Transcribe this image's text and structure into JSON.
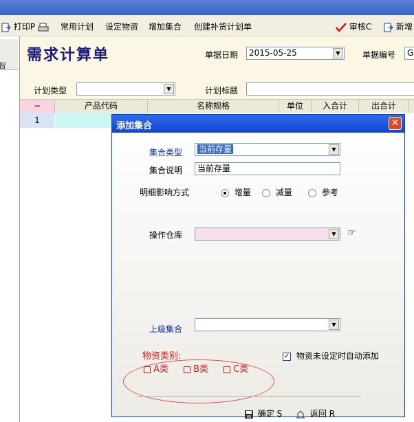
{
  "toolbar": {
    "print_label": "打印P",
    "common_plan_label": "常用计划",
    "set_material_label": "设定物资",
    "add_set_label": "增加集合",
    "create_replenish_label": "创建补货计划单",
    "approve_label": "审核C",
    "new_label": "新增"
  },
  "left_rail": {
    "tab_label": "智"
  },
  "form": {
    "title": "需求计算单",
    "doc_date_label": "单据日期",
    "doc_date_value": "2015-05-25",
    "doc_no_label": "单据编号",
    "doc_no_value": "G",
    "plan_type_label": "计划类型",
    "plan_type_value": "",
    "plan_title_label": "计划标题",
    "plan_title_value": ""
  },
  "grid": {
    "columns": [
      "−",
      "产品代码",
      "名称规格",
      "单位",
      "入合计",
      "出合计"
    ],
    "rows": [
      {
        "index": "1"
      }
    ]
  },
  "dialog": {
    "title": "添加集合",
    "set_type_label": "集合类型",
    "set_type_value": "当前存量",
    "set_desc_label": "集合说明",
    "set_desc_value": "当前存量",
    "detail_mode_label": "明细影响方式",
    "mode_options": [
      "增量",
      "减量",
      "参考"
    ],
    "mode_selected": "增量",
    "warehouse_label": "操作仓库",
    "warehouse_value": "",
    "parent_set_label": "上级集合",
    "parent_set_value": "",
    "category_title": "物资类别:",
    "category_options": [
      "A类",
      "B类",
      "C类"
    ],
    "auto_add_label": "物资未设定时自动添加",
    "auto_add_checked": true,
    "ok_label": "确定 S",
    "back_label": "返回 R"
  }
}
